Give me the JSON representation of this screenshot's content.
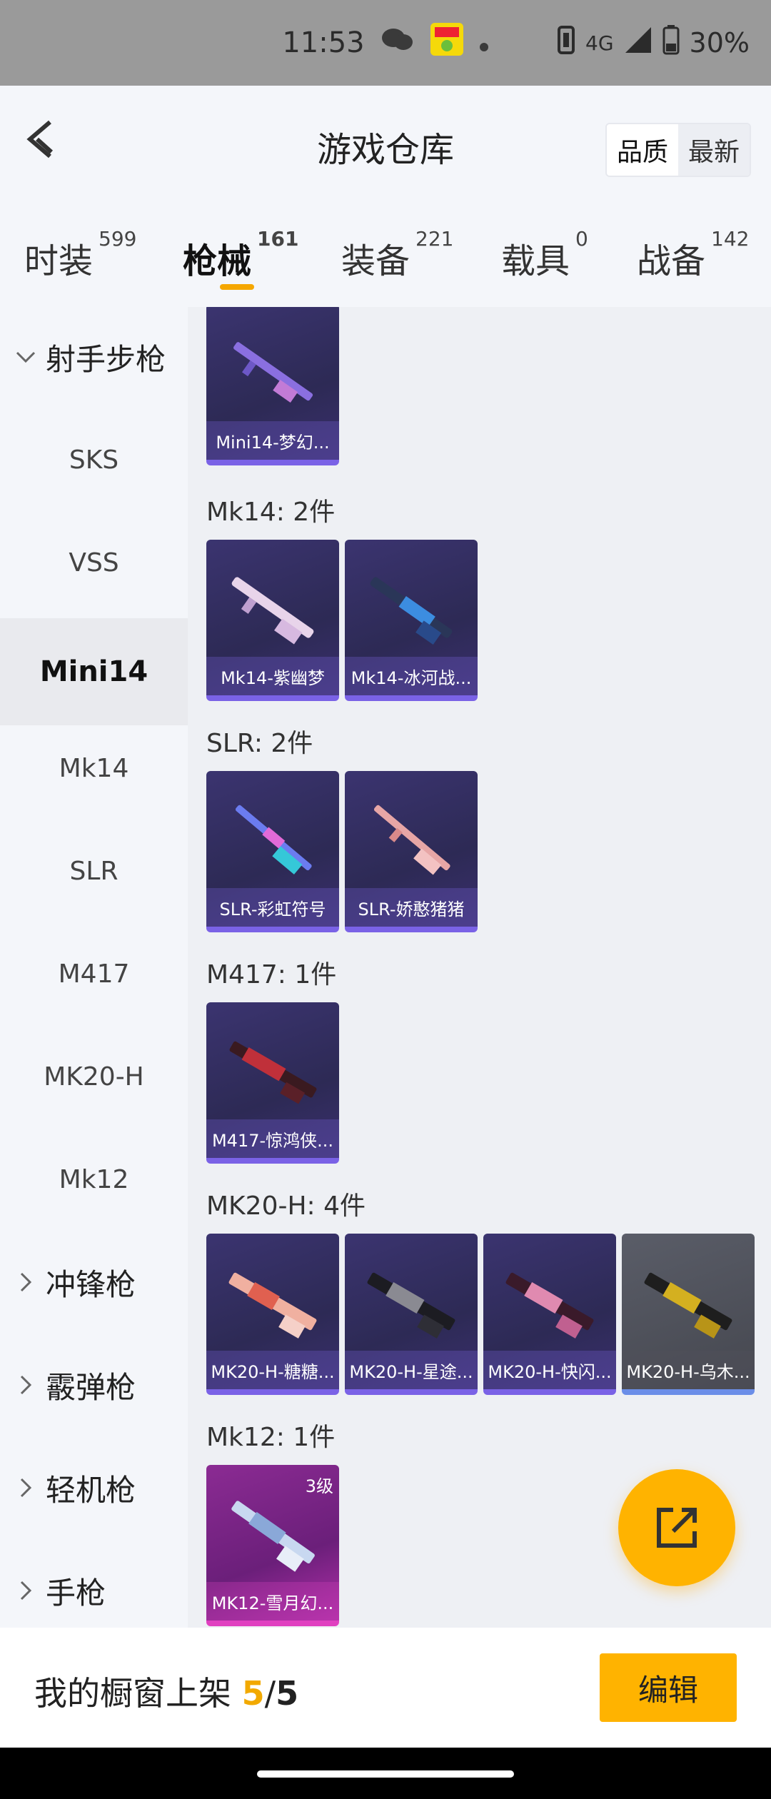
{
  "status_bar": {
    "time": "11:53",
    "network": "4G",
    "battery": "30%"
  },
  "header": {
    "title": "游戏仓库",
    "sort_quality": "品质",
    "sort_latest": "最新"
  },
  "tabs": [
    {
      "label": "时装",
      "count": "599"
    },
    {
      "label": "枪械",
      "count": "161"
    },
    {
      "label": "装备",
      "count": "221"
    },
    {
      "label": "载具",
      "count": "0"
    },
    {
      "label": "战备",
      "count": "142"
    }
  ],
  "sidebar": {
    "group_marksman": "射手步枪",
    "items": [
      "SKS",
      "VSS",
      "Mini14",
      "Mk14",
      "SLR",
      "M417",
      "MK20-H",
      "Mk12"
    ],
    "groups_collapsed": [
      "冲锋枪",
      "霰弹枪",
      "轻机枪",
      "手枪"
    ]
  },
  "sections": [
    {
      "title": "",
      "cards": [
        {
          "name": "Mini14-梦幻..."
        }
      ]
    },
    {
      "title": "Mk14: 2件",
      "cards": [
        {
          "name": "Mk14-紫幽梦"
        },
        {
          "name": "Mk14-冰河战..."
        }
      ]
    },
    {
      "title": "SLR: 2件",
      "cards": [
        {
          "name": "SLR-彩虹符号"
        },
        {
          "name": "SLR-娇憨猪猪"
        }
      ]
    },
    {
      "title": "M417: 1件",
      "cards": [
        {
          "name": "M417-惊鸿侠..."
        }
      ]
    },
    {
      "title": "MK20-H: 4件",
      "cards": [
        {
          "name": "MK20-H-糖糖..."
        },
        {
          "name": "MK20-H-星途..."
        },
        {
          "name": "MK20-H-快闪..."
        },
        {
          "name": "MK20-H-乌木..."
        }
      ]
    },
    {
      "title": "Mk12: 1件",
      "cards": [
        {
          "name": "MK12-雪月幻...",
          "level": "3级"
        }
      ]
    }
  ],
  "bottom": {
    "label": "我的橱窗上架",
    "count": "5",
    "sep": "/",
    "total": "5",
    "edit": "编辑"
  },
  "colors": {
    "accent": "#ffb300",
    "purple": "#7a62e6",
    "pink": "#e040c0"
  }
}
